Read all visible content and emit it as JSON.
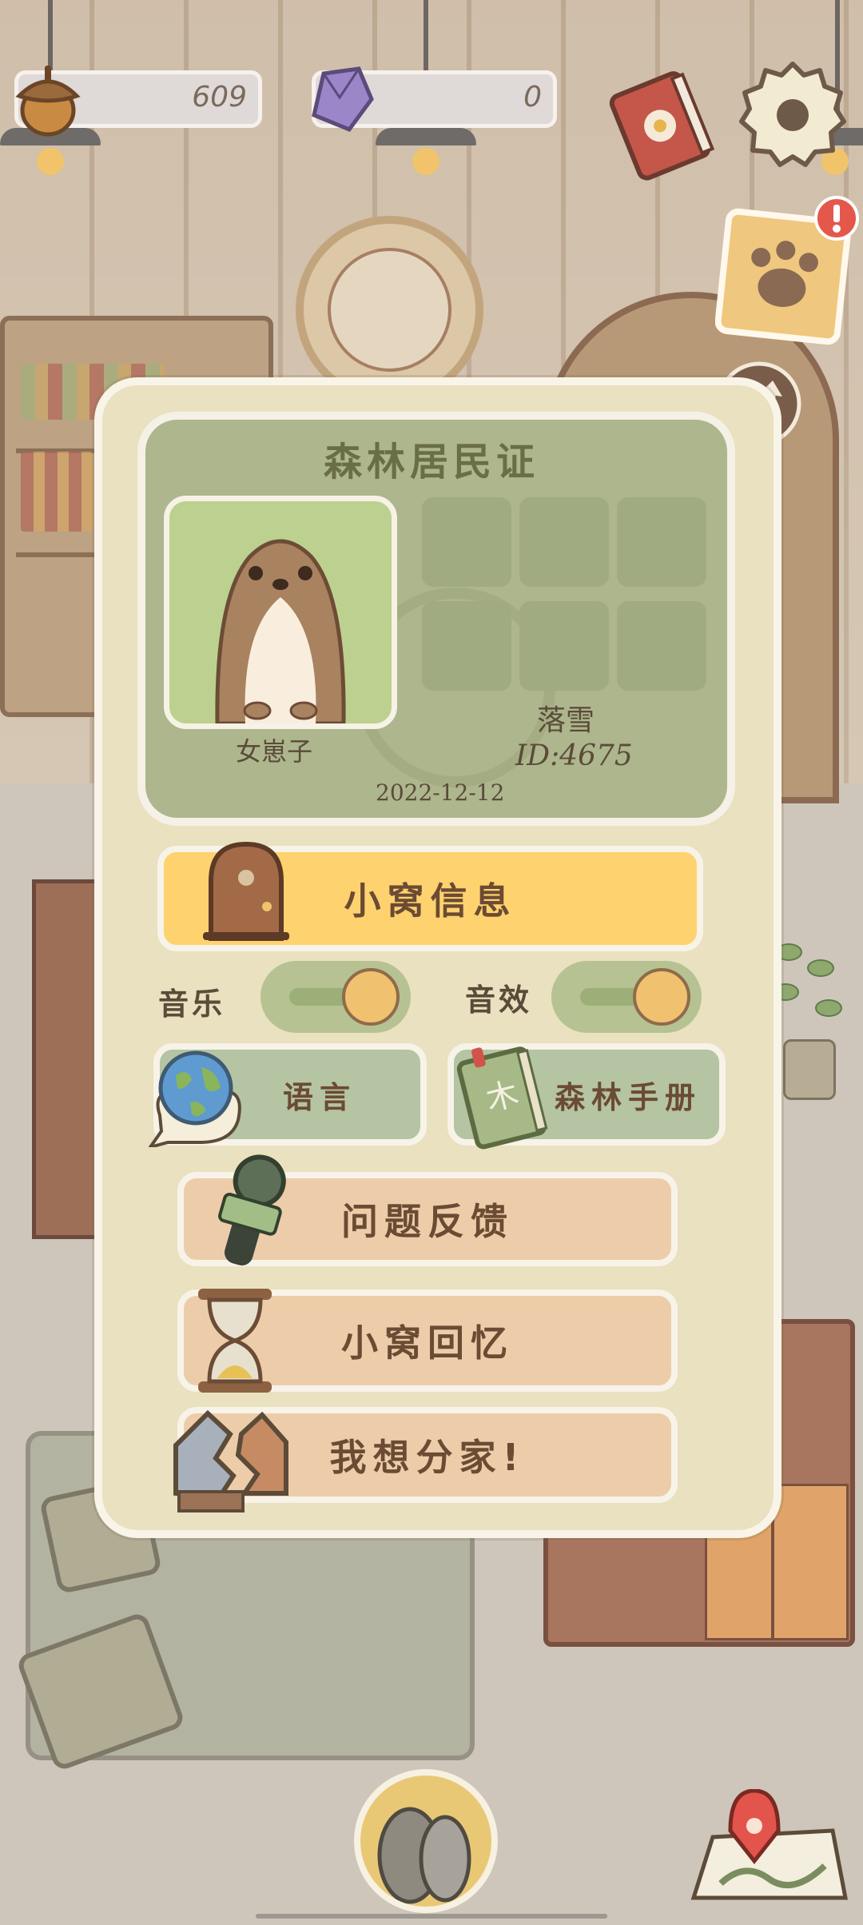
{
  "currency": {
    "acorns": "609",
    "gems": "0"
  },
  "card": {
    "title": "森林居民证",
    "avatar_name": "女崽子",
    "username": "落雪",
    "user_id": "ID:4675",
    "date": "2022-12-12"
  },
  "menu": {
    "house_info": "小窝信息",
    "music_label": "音乐",
    "sfx_label": "音效",
    "language": "语言",
    "forest_handbook": "森林手册",
    "feedback": "问题反馈",
    "house_memories": "小窝回忆",
    "move_out": "我想分家!"
  },
  "toggles": {
    "music_on": true,
    "sfx_on": true
  },
  "icons": [
    "acorn-icon",
    "gem-icon",
    "journal-book-icon",
    "settings-gear-icon",
    "paw-note-icon",
    "alert-icon",
    "back-arrow-icon",
    "door-icon",
    "globe-speech-icon",
    "handbook-icon",
    "microphone-icon",
    "hourglass-icon",
    "broken-house-icon",
    "map-pin-icon",
    "stones-icon"
  ]
}
